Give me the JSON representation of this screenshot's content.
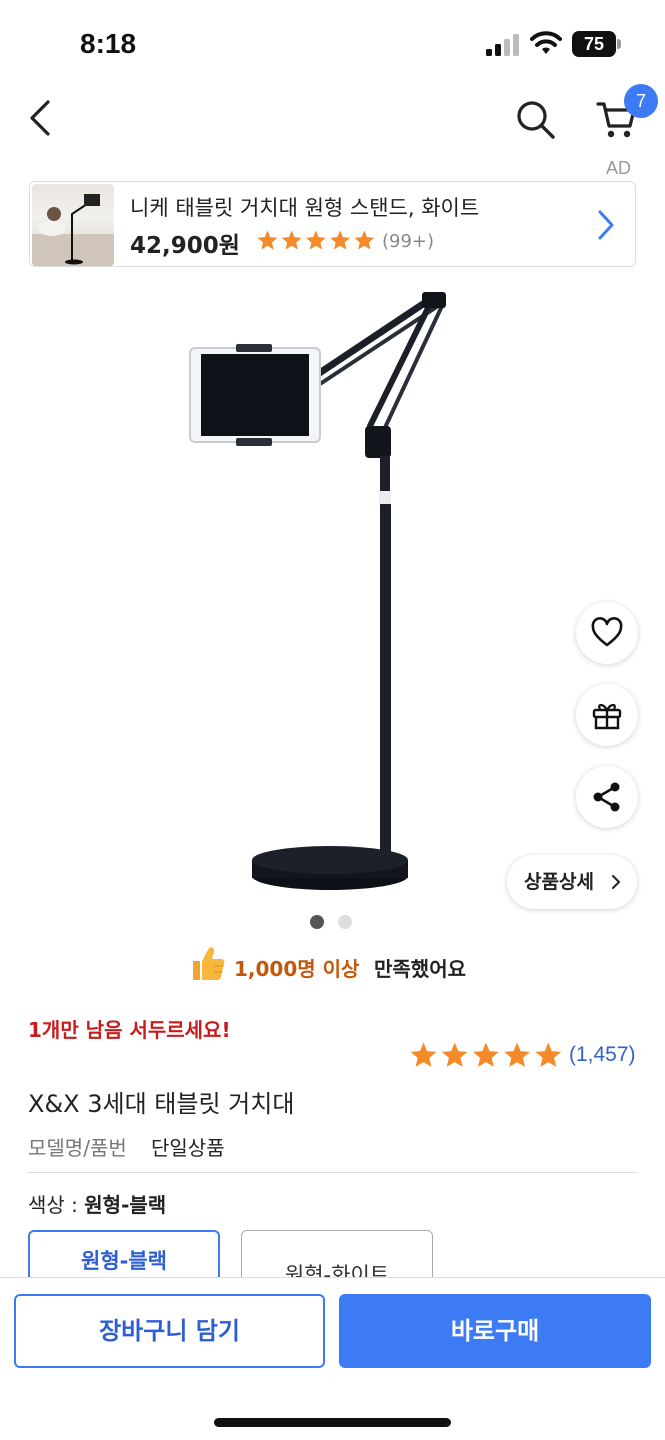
{
  "status_bar": {
    "time": "8:18",
    "battery": "75"
  },
  "header": {
    "cart_count": "7",
    "ad_label": "AD"
  },
  "ad": {
    "title": "니케 태블릿 거치대 원형 스탠드, 화이트",
    "price": "42,900원",
    "rating": 5,
    "review_count": "(99+)"
  },
  "gallery": {
    "detail_button": "상품상세",
    "total_images": 2,
    "current_index": 1
  },
  "satisfaction": {
    "highlight": "1,000명 이상",
    "rest": "만족했어요"
  },
  "stock_notice": "1개만 남음 서두르세요!",
  "rating": {
    "stars": 5,
    "count": "(1,457)"
  },
  "product": {
    "title": "X&X 3세대 태블릿 거치대",
    "model_label": "모델명/품번",
    "model_value": "단일상품"
  },
  "options": {
    "label": "색상 : ",
    "selected": "원형-블랙",
    "choices": [
      "원형-블랙",
      "원형-화이트"
    ]
  },
  "actions": {
    "add_to_cart": "장바구니 담기",
    "buy_now": "바로구매"
  },
  "colors": {
    "accent": "#3d7bf5",
    "star": "#f58a2a",
    "urgent": "#c81c1c",
    "highlight": "#c4570a"
  },
  "icons": [
    "back-icon",
    "search-icon",
    "cart-icon",
    "heart-icon",
    "gift-icon",
    "share-icon",
    "thumbs-up-icon",
    "chevron-right-icon",
    "star-icon"
  ]
}
